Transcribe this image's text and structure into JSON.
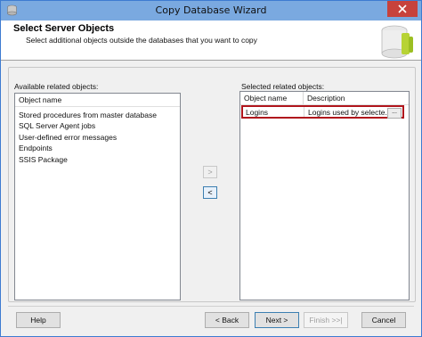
{
  "window": {
    "title": "Copy Database Wizard"
  },
  "header": {
    "title": "Select Server Objects",
    "subtitle": "Select additional objects outside the databases that you want to copy"
  },
  "available": {
    "label": "Available related objects:",
    "column": "Object name",
    "items": [
      "Stored procedures from master database",
      "SQL Server Agent jobs",
      "User-defined error messages",
      "Endpoints",
      "SSIS Package"
    ]
  },
  "selected": {
    "label": "Selected related objects:",
    "columns": [
      "Object name",
      "Description"
    ],
    "rows": [
      {
        "name": "Logins",
        "description": "Logins used by selecte...",
        "button": "..."
      }
    ]
  },
  "move": {
    "add": ">",
    "remove": "<"
  },
  "buttons": {
    "help": "Help",
    "back": "< Back",
    "next": "Next >",
    "finish": "Finish >>|",
    "cancel": "Cancel"
  }
}
